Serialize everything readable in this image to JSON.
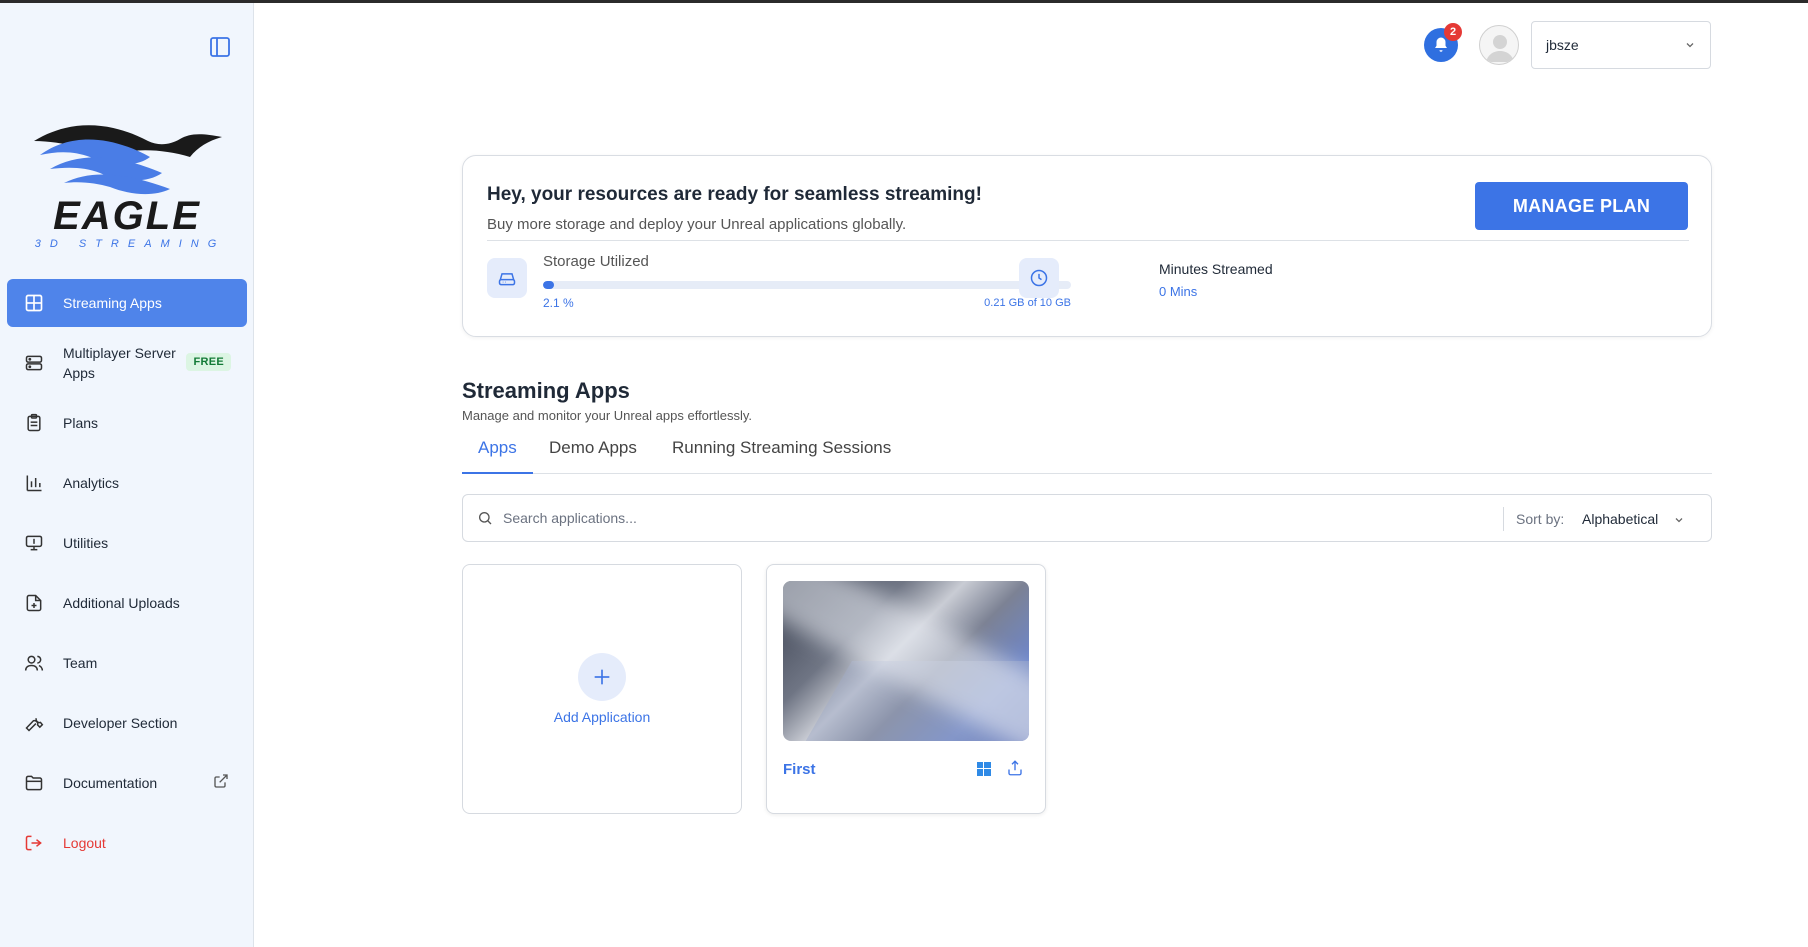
{
  "sidebar": {
    "brand_name": "EAGLE",
    "brand_tagline": "3D STREAMING",
    "items": [
      {
        "label": "Streaming Apps",
        "icon": "grid-icon",
        "active": true
      },
      {
        "label": "Multiplayer Server Apps",
        "icon": "server-icon",
        "badge": "FREE"
      },
      {
        "label": "Plans",
        "icon": "clipboard-icon"
      },
      {
        "label": "Analytics",
        "icon": "bar-chart-icon"
      },
      {
        "label": "Utilities",
        "icon": "monitor-icon"
      },
      {
        "label": "Additional Uploads",
        "icon": "file-plus-icon"
      },
      {
        "label": "Team",
        "icon": "users-icon"
      },
      {
        "label": "Developer Section",
        "icon": "wrench-icon"
      },
      {
        "label": "Documentation",
        "icon": "folder-icon",
        "external": true
      },
      {
        "label": "Logout",
        "icon": "logout-icon"
      }
    ]
  },
  "header": {
    "notification_count": "2",
    "username": "jbsze"
  },
  "resources": {
    "title": "Hey, your resources are ready for seamless streaming!",
    "subtitle": "Buy more storage and deploy your Unreal applications globally.",
    "manage_button": "MANAGE PLAN",
    "storage_label": "Storage Utilized",
    "storage_percent_text": "2.1 %",
    "storage_fraction": 0.021,
    "storage_used_text": "0.21 GB of 10 GB",
    "minutes_label": "Minutes Streamed",
    "minutes_value": "0 Mins"
  },
  "section": {
    "title": "Streaming Apps",
    "subtitle": "Manage and monitor your Unreal apps effortlessly.",
    "tabs": [
      {
        "label": "Apps",
        "active": true
      },
      {
        "label": "Demo Apps"
      },
      {
        "label": "Running Streaming Sessions"
      }
    ]
  },
  "search": {
    "placeholder": "Search applications...",
    "sort_label": "Sort by:",
    "sort_value": "Alphabetical"
  },
  "apps": {
    "add_label": "Add Application",
    "items": [
      {
        "name": "First",
        "platform_icon": "windows-icon",
        "action_icon": "upload-icon"
      }
    ]
  },
  "colors": {
    "accent": "#3c74e6",
    "sidebar_bg": "#f1f6fd",
    "active_nav": "#4f84ea",
    "logout": "#e53935",
    "free_badge_bg": "#dcf5e3"
  }
}
